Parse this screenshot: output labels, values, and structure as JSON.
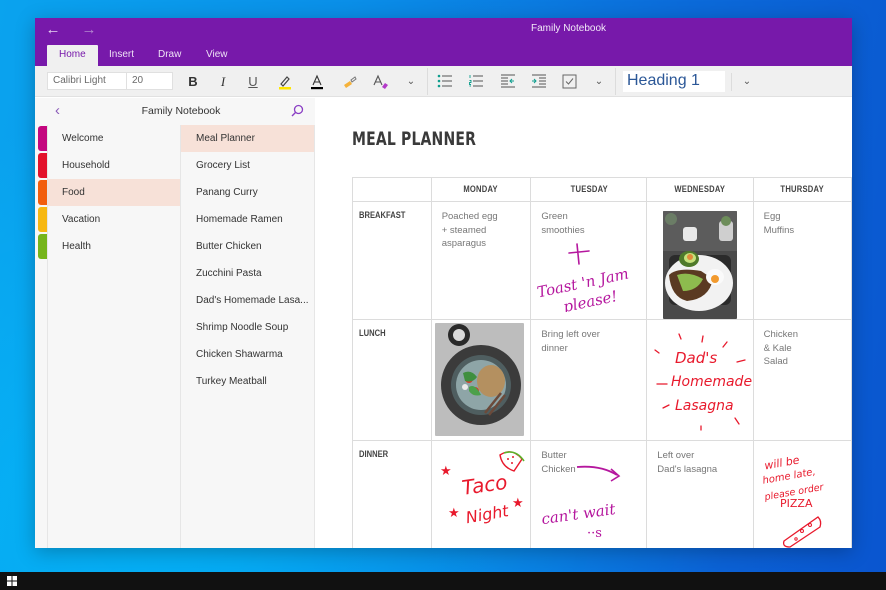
{
  "window": {
    "title": "Family Notebook",
    "nav_back_icon": "←",
    "nav_forward_icon": "→"
  },
  "tabs": [
    {
      "label": "Home",
      "active": true
    },
    {
      "label": "Insert",
      "active": false
    },
    {
      "label": "Draw",
      "active": false
    },
    {
      "label": "View",
      "active": false
    }
  ],
  "ribbon": {
    "font_name": "Calibri Light",
    "font_size": "20",
    "bold": "B",
    "italic": "I",
    "underline": "U",
    "style": "Heading 1",
    "highlight_color": "#ffe600",
    "font_color": "#000000",
    "list_accent": "#0f9e8e"
  },
  "navigation": {
    "notebook_title": "Family Notebook",
    "back_icon": "‹",
    "sections": [
      {
        "label": "Welcome",
        "color": "#c4077f",
        "active": false
      },
      {
        "label": "Household",
        "color": "#e3122b",
        "active": false
      },
      {
        "label": "Food",
        "color": "#f25e0d",
        "active": true
      },
      {
        "label": "Vacation",
        "color": "#f7b812",
        "active": false
      },
      {
        "label": "Health",
        "color": "#76b51b",
        "active": false
      }
    ],
    "pages": [
      {
        "label": "Meal Planner",
        "active": true
      },
      {
        "label": "Grocery List",
        "active": false
      },
      {
        "label": "Panang Curry",
        "active": false
      },
      {
        "label": "Homemade Ramen",
        "active": false
      },
      {
        "label": "Butter Chicken",
        "active": false
      },
      {
        "label": "Zucchini Pasta",
        "active": false
      },
      {
        "label": "Dad's Homemade Lasa...",
        "active": false
      },
      {
        "label": "Shrimp Noodle Soup",
        "active": false
      },
      {
        "label": "Chicken Shawarma",
        "active": false
      },
      {
        "label": "Turkey Meatball",
        "active": false
      }
    ]
  },
  "page": {
    "title": "MEAL PLANNER",
    "columns": [
      "",
      "MONDAY",
      "TUESDAY",
      "WEDNESDAY",
      "THURSDAY"
    ],
    "rows": [
      {
        "label": "BREAKFAST",
        "monday": "Poached egg\n+ steamed\nasparagus",
        "tuesday": "Green\nsmoothies",
        "tuesday_ink": "+ Toast 'n Jam please!",
        "wednesday_image": "avocado-toast-photo",
        "thursday": "Egg\nMuffins"
      },
      {
        "label": "LUNCH",
        "monday_image": "salad-bowl-photo",
        "tuesday": "Bring left over\ndinner",
        "wednesday_ink": [
          "Dad's",
          "- Homemade",
          "Lasagna"
        ],
        "thursday": "Chicken\n& Kale\nSalad"
      },
      {
        "label": "DINNER",
        "monday_ink": [
          "Taco",
          "Night"
        ],
        "tuesday": "Butter\nChicken",
        "tuesday_ink": "can't wait :s",
        "wednesday": "Left over\nDad's lasagna",
        "thursday_ink": [
          "will be",
          "home late,",
          "please order",
          "PIZZA"
        ]
      }
    ],
    "ink_colors": {
      "purple": "#b5179e",
      "red": "#e8192c"
    }
  },
  "taskbar": {
    "start_icon": "windows-logo"
  }
}
